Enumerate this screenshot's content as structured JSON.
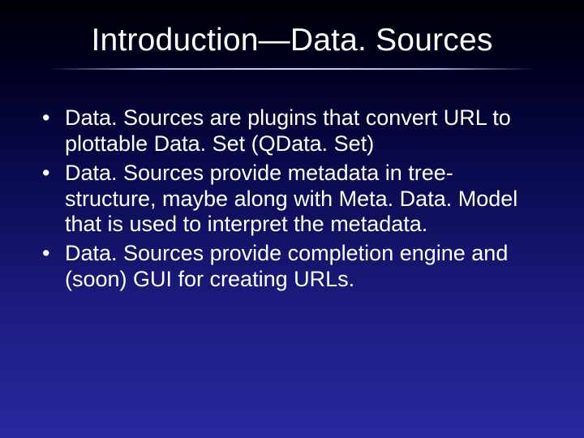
{
  "slide": {
    "title": "Introduction—Data. Sources",
    "bullets": [
      "Data. Sources are plugins that convert URL to plottable Data. Set (QData. Set)",
      "Data. Sources provide metadata in tree-structure, maybe along with Meta. Data. Model that is used to interpret the metadata.",
      "Data. Sources provide completion engine and (soon) GUI for creating URLs."
    ]
  }
}
